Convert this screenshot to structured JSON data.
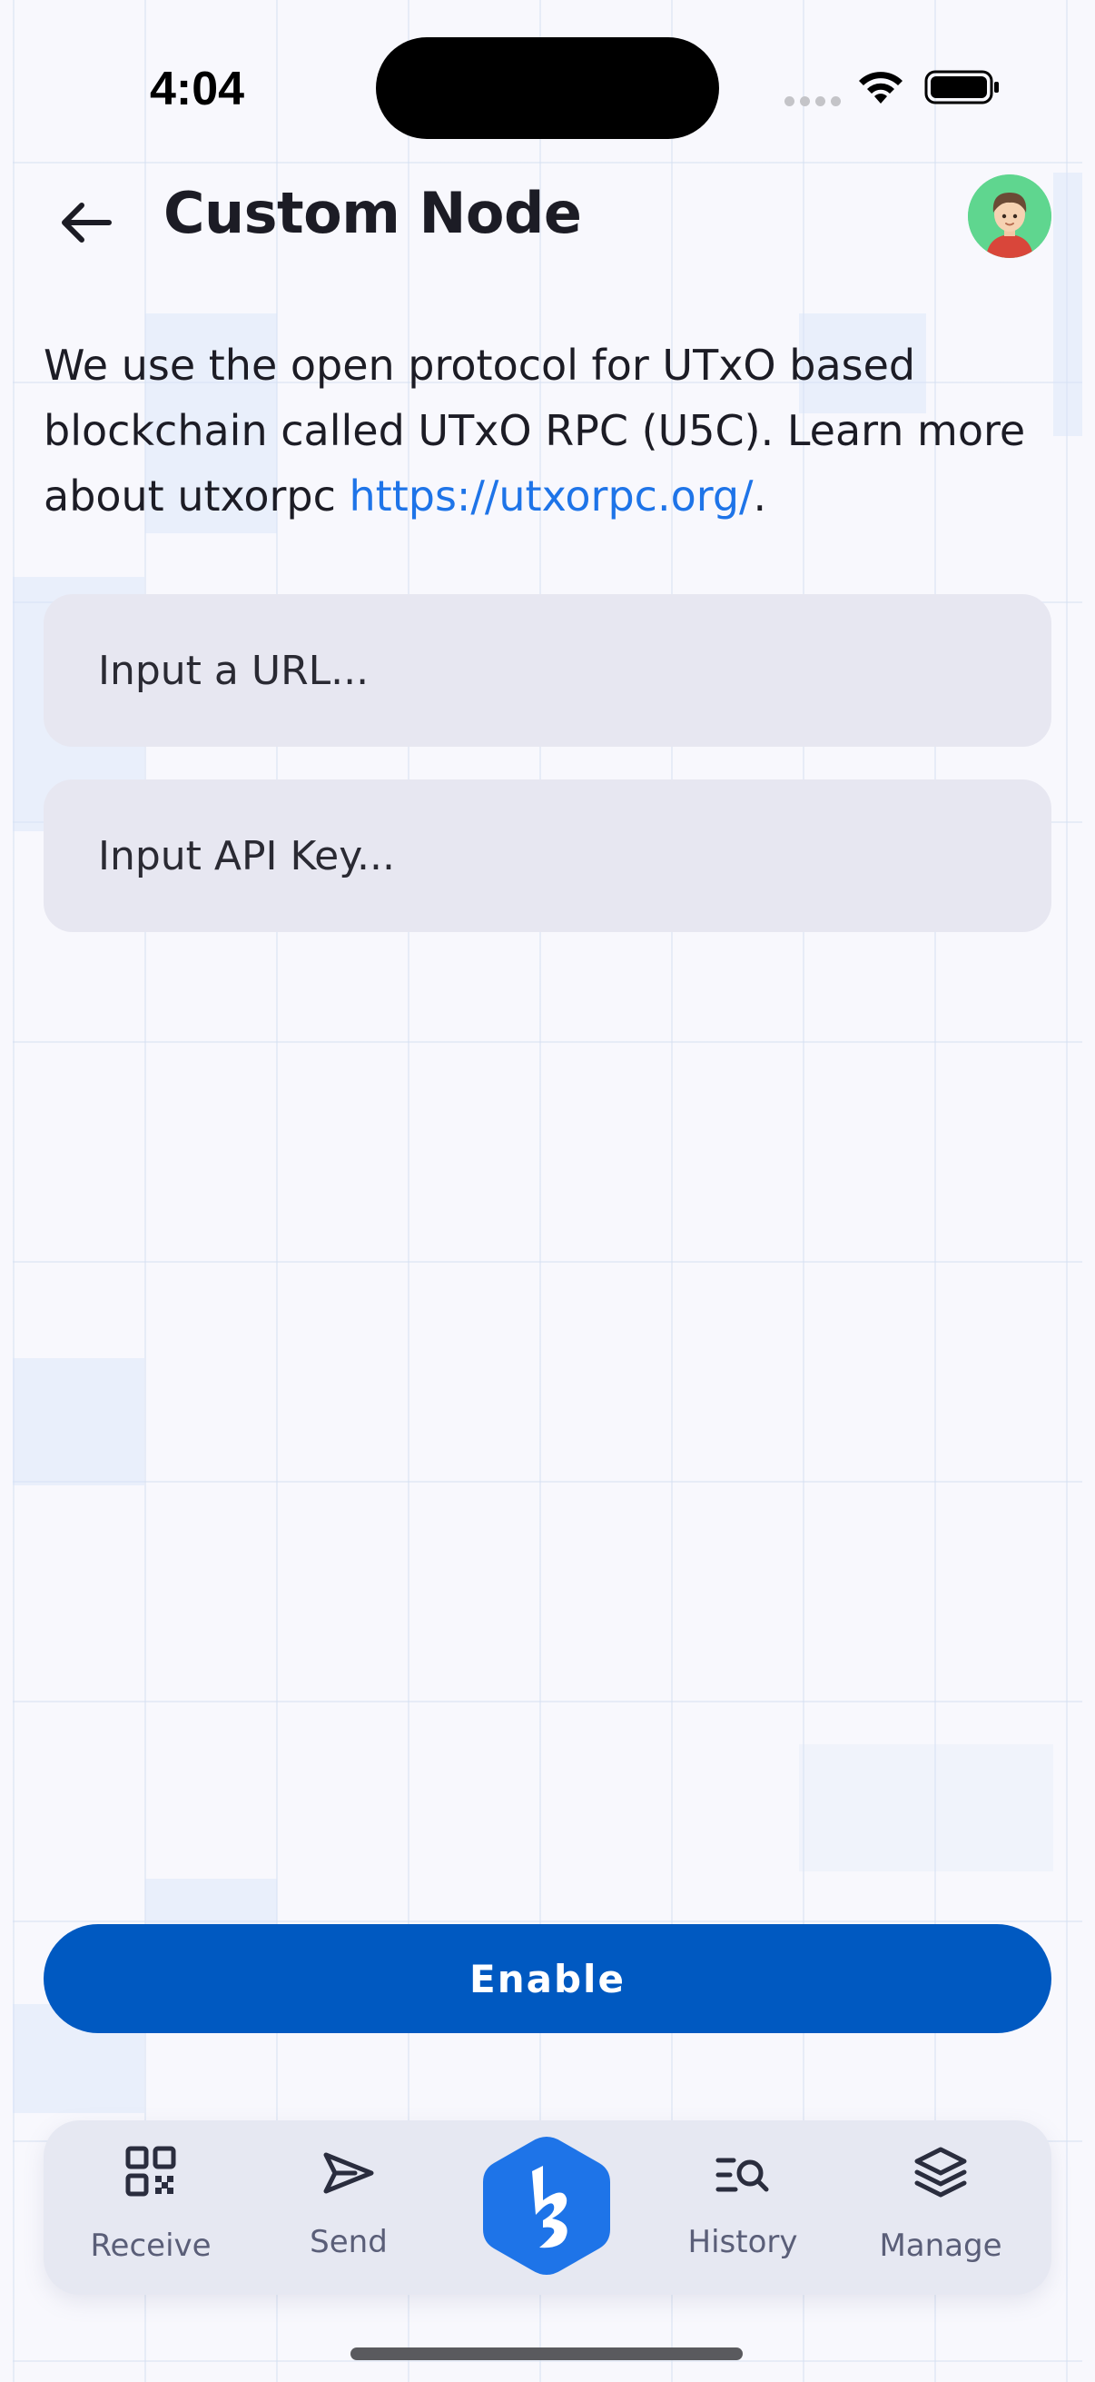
{
  "status_bar": {
    "time": "4:04"
  },
  "header": {
    "title": "Custom Node"
  },
  "description": {
    "text": "We use the open protocol for UTxO based blockchain called UTxO RPC (U5C). Learn more about utxorpc ",
    "link_text": "https://utxorpc.org/",
    "suffix": "."
  },
  "form": {
    "url_placeholder": "Input a URL...",
    "url_value": "",
    "api_key_placeholder": "Input API Key...",
    "api_key_value": ""
  },
  "enable_button": {
    "label": "Enable"
  },
  "bottom_nav": {
    "items": [
      {
        "label": "Receive",
        "icon": "qr-code-icon"
      },
      {
        "label": "Send",
        "icon": "send-icon"
      },
      {
        "label": "",
        "icon": "app-logo-icon"
      },
      {
        "label": "History",
        "icon": "history-search-icon"
      },
      {
        "label": "Manage",
        "icon": "layers-icon"
      }
    ]
  },
  "colors": {
    "accent": "#0059c1",
    "link": "#1e74e8",
    "background": "#f8f8fd",
    "input_background": "#e7e7f1",
    "avatar_background": "#5fd68f"
  }
}
